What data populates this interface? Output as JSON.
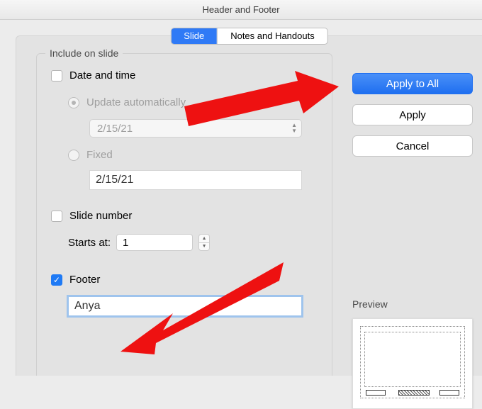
{
  "window": {
    "title": "Header and Footer"
  },
  "tabs": {
    "slide": "Slide",
    "notes": "Notes and Handouts"
  },
  "group": {
    "title": "Include on slide"
  },
  "datetime": {
    "label": "Date and time",
    "update_auto": "Update automatically",
    "auto_value": "2/15/21",
    "fixed": "Fixed",
    "fixed_value": "2/15/21"
  },
  "slidenum": {
    "label": "Slide number",
    "starts_at_label": "Starts at:",
    "starts_at_value": "1"
  },
  "footer": {
    "label": "Footer",
    "value": "Anya"
  },
  "buttons": {
    "apply_all": "Apply to All",
    "apply": "Apply",
    "cancel": "Cancel"
  },
  "preview": {
    "label": "Preview"
  }
}
